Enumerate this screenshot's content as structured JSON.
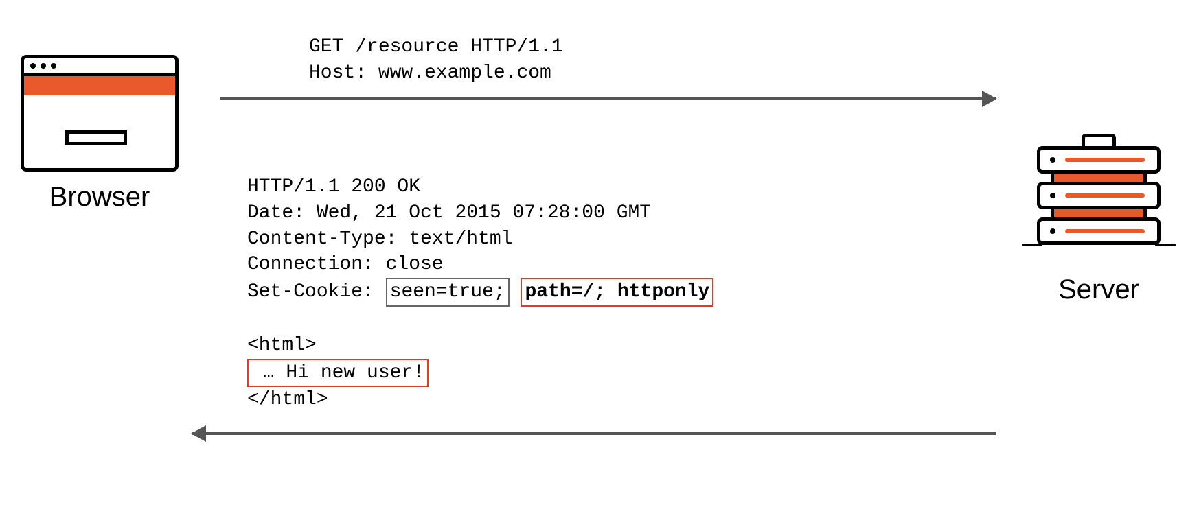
{
  "browser": {
    "label": "Browser"
  },
  "server": {
    "label": "Server"
  },
  "request": {
    "line1": "GET /resource HTTP/1.1",
    "line2": "Host: www.example.com"
  },
  "response": {
    "status_line": "HTTP/1.1 200 OK",
    "date_line": "Date: Wed, 21 Oct 2015 07:28:00 GMT",
    "content_type_line": "Content-Type: text/html",
    "connection_line": "Connection: close",
    "set_cookie_label": "Set-Cookie: ",
    "cookie_value": "seen=true;",
    "cookie_attrs": "path=/; httponly",
    "body_open": "<html>",
    "body_content": " … Hi new user!",
    "body_close": "</html>"
  }
}
